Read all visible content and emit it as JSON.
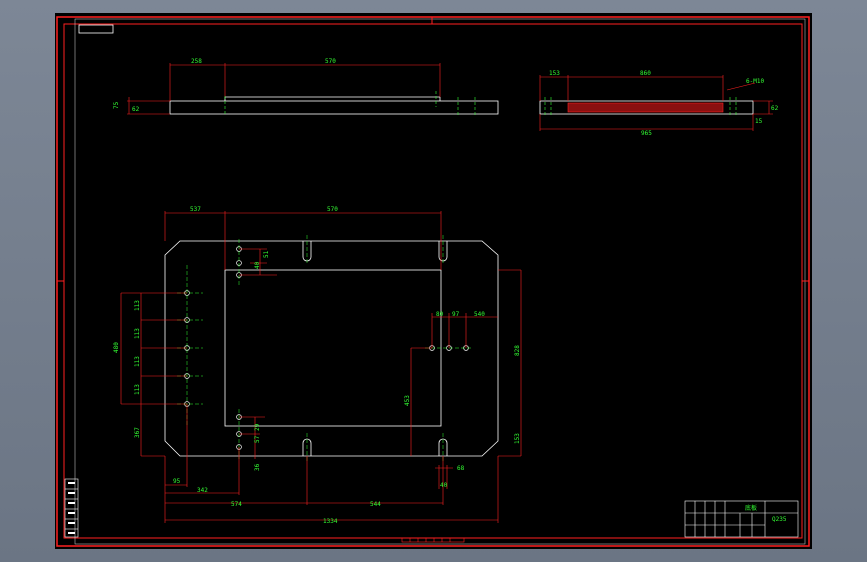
{
  "drawing": {
    "title_block": {
      "label": "底板",
      "material": "Q235"
    },
    "top_view_dims": {
      "left_width": "258",
      "main_width": "570",
      "height_a": "75",
      "height_b": "62"
    },
    "right_view_dims": {
      "left": "153",
      "main": "860",
      "hole": "6-M10",
      "height": "62",
      "total": "965",
      "step": "15"
    },
    "plan_dims": {
      "top_left": "537",
      "top_main": "570",
      "hole_pitch_v": [
        "113",
        "113",
        "113",
        "113"
      ],
      "hole_span_v": "480",
      "bottom_left_v": "367",
      "small_a": "51",
      "small_b": "40",
      "small_c": "29",
      "small_d": "57",
      "small_e": "36",
      "right_a": "80",
      "right_b": "97",
      "right_c": "540",
      "right_height": "828",
      "right_v": "453",
      "right_bottom": "153",
      "slot_w": "68",
      "slot_d": "40",
      "bottom_left": "95",
      "bottom_mid": "342",
      "bottom_574": "574",
      "bottom_544": "544",
      "overall": "1334"
    }
  }
}
